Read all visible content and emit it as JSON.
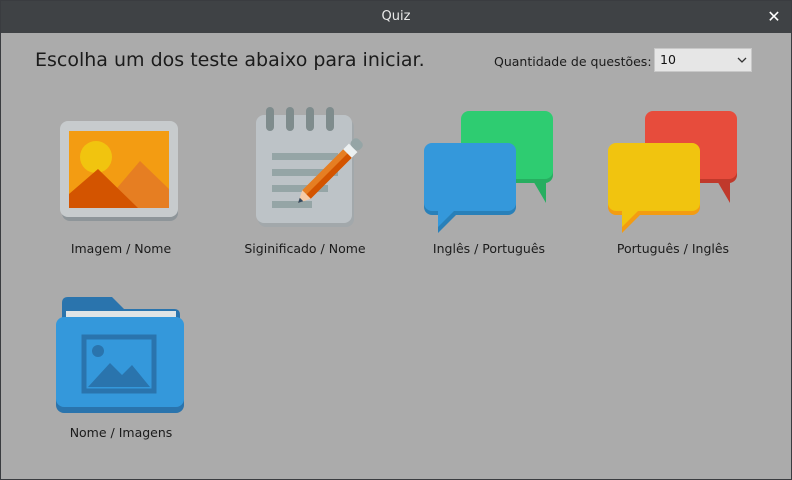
{
  "window": {
    "title": "Quiz",
    "close_glyph": "✕"
  },
  "heading": "Escolha um dos teste abaixo para iniciar.",
  "quantity": {
    "label": "Quantidade de questões:",
    "selected": "10"
  },
  "tests": [
    {
      "label": "Imagem / Nome",
      "icon": "picture-icon"
    },
    {
      "label": "Siginificado / Nome",
      "icon": "notepad-pencil-icon"
    },
    {
      "label": "Inglês / Português",
      "icon": "speech-bubbles-blue-green-icon"
    },
    {
      "label": "Português / Inglês",
      "icon": "speech-bubbles-yellow-red-icon"
    },
    {
      "label": "Nome / Imagens",
      "icon": "image-folder-icon"
    }
  ],
  "colors": {
    "background": "#ababab",
    "titlebar": "#3f4245",
    "picture_orange": "#f39c12",
    "green": "#2ecc71",
    "blue": "#3498db",
    "yellow": "#f1c40f",
    "red": "#e74c3c"
  }
}
